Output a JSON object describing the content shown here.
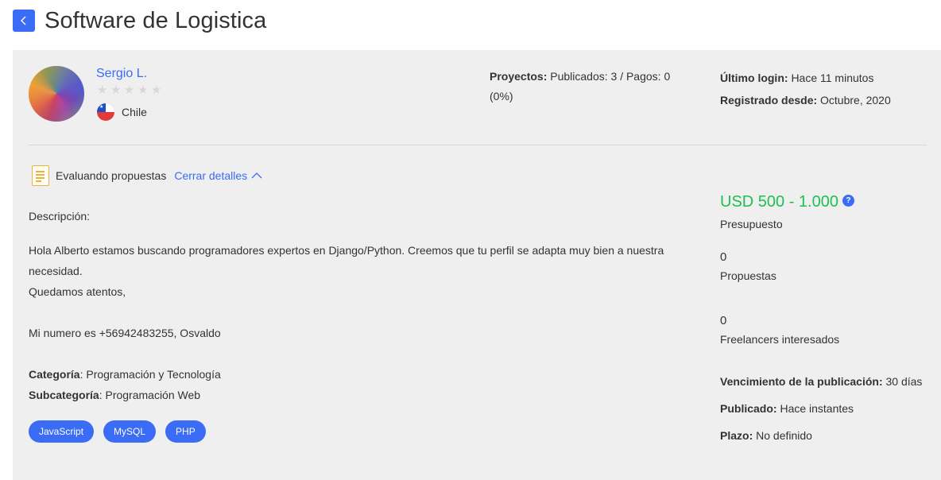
{
  "header": {
    "title": "Software de Logistica"
  },
  "user": {
    "name": "Sergio L.",
    "rating": 0,
    "rating_max": 5,
    "country": "Chile"
  },
  "projects": {
    "label": "Proyectos:",
    "value": "Publicados: 3 / Pagos: 0 (0%)"
  },
  "account": {
    "last_login_label": "Último login:",
    "last_login_value": "Hace 11 minutos",
    "registered_label": "Registrado desde:",
    "registered_value": "Octubre, 2020"
  },
  "status": {
    "label": "Evaluando propuestas",
    "toggle_label": "Cerrar detalles"
  },
  "description": {
    "heading": "Descripción:",
    "lines": [
      "Hola Alberto estamos buscando programadores expertos en Django/Python. Creemos que tu perfil se adapta muy bien a nuestra necesidad.",
      "Quedamos atentos,",
      "",
      "Mi numero es +56942483255, Osvaldo"
    ]
  },
  "classification": {
    "category_label": "Categoría",
    "category_value": ": Programación y Tecnología",
    "subcategory_label": "Subcategoría",
    "subcategory_value": ": Programación Web"
  },
  "skills": [
    "JavaScript",
    "MySQL",
    "PHP"
  ],
  "stats": {
    "budget": "USD 500 - 1.000",
    "budget_label": "Presupuesto",
    "help_glyph": "?",
    "proposals_count": "0",
    "proposals_label": "Propuestas",
    "interested_count": "0",
    "interested_label": "Freelancers interesados"
  },
  "publication": {
    "expiry_label": "Vencimiento de la publicación:",
    "expiry_value": "30 días",
    "published_label": "Publicado:",
    "published_value": "Hace instantes",
    "term_label": "Plazo:",
    "term_value": "No definido"
  },
  "colors": {
    "accent": "#3b6cf6",
    "budget": "#1fbf52",
    "panel": "#efefef",
    "doc_icon": "#f0b13b"
  }
}
